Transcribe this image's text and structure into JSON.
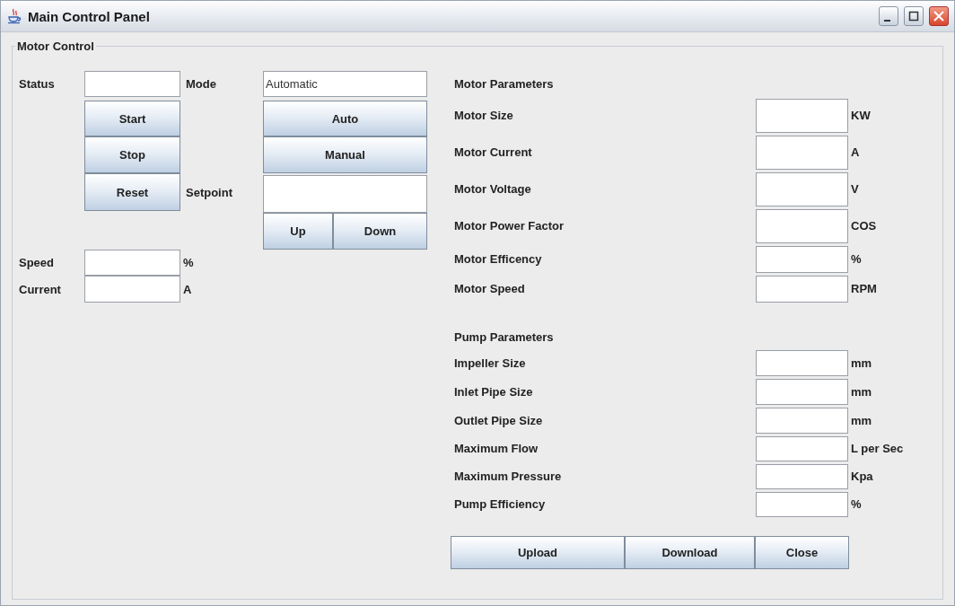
{
  "window": {
    "title": "Main Control Panel"
  },
  "group": {
    "title": "Motor Control"
  },
  "controls": {
    "status_label": "Status",
    "mode_label": "Mode",
    "mode_value": "Automatic",
    "state_buttons": [
      "Start",
      "Stop",
      "Reset"
    ],
    "mode_buttons": [
      "Auto",
      "Manual"
    ],
    "setpoint_label": "Setpoint",
    "step_buttons": [
      "Up",
      "Down"
    ]
  },
  "readings": [
    {
      "label": "Speed",
      "unit": "%"
    },
    {
      "label": "Current",
      "unit": "A"
    }
  ],
  "motor_parameters": {
    "title": "Motor Parameters",
    "rows": [
      {
        "label": "Motor Size",
        "unit": "KW"
      },
      {
        "label": "Motor Current",
        "unit": "A"
      },
      {
        "label": "Motor Voltage",
        "unit": "V"
      },
      {
        "label": "Motor Power Factor",
        "unit": "COS"
      },
      {
        "label": "Motor Efficency",
        "unit": "%"
      },
      {
        "label": "Motor Speed",
        "unit": "RPM"
      }
    ]
  },
  "pump_parameters": {
    "title": "Pump Parameters",
    "rows": [
      {
        "label": "Impeller Size",
        "unit": "mm"
      },
      {
        "label": "Inlet Pipe Size",
        "unit": "mm"
      },
      {
        "label": "Outlet Pipe Size",
        "unit": "mm"
      },
      {
        "label": "Maximum Flow",
        "unit": "L per Sec"
      },
      {
        "label": "Maximum Pressure",
        "unit": "Kpa"
      },
      {
        "label": "Pump Efficiency",
        "unit": "%"
      }
    ]
  },
  "buttons": [
    "Upload",
    "Download",
    "Close"
  ]
}
